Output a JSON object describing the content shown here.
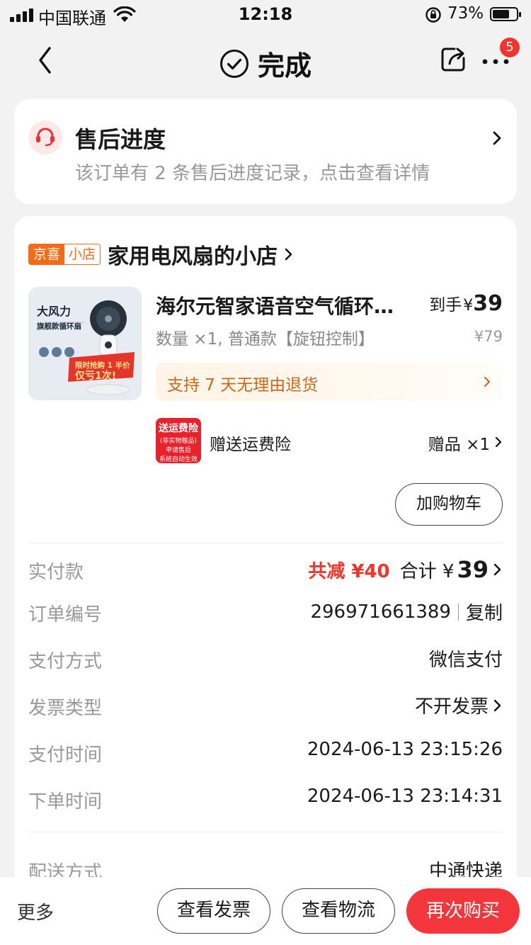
{
  "status_bar": {
    "carrier": "中国联通",
    "time": "12:18",
    "battery_percent_text": "73%",
    "battery_level": 0.73
  },
  "nav": {
    "title": "完成",
    "badge_count": "5"
  },
  "after_sale": {
    "title": "售后进度",
    "subtitle": "该订单有 2 条售后进度记录，点击查看详情"
  },
  "shop": {
    "tag_left": "京喜",
    "tag_right": "小店",
    "name": "家用电风扇的小店"
  },
  "product": {
    "title": "海尔元智家语音空气循环扇大风力旗舰款循环扇",
    "price_label": "到手",
    "price_currency": "¥",
    "price": "39",
    "spec": "数量 ×1, 普通款【旋钮控制】",
    "original_price": "¥79",
    "image_text_main": "大风力",
    "image_text_sub": "旗舰款循环扇",
    "image_promo_line1": "限时抢购 1 半价",
    "image_promo_line2": "仅亏1次!"
  },
  "return_policy": {
    "text": "支持 7 天无理由退货"
  },
  "gift": {
    "image_line1": "送运费险",
    "image_line2": "(非实物赠品)",
    "image_line3": "申请售后",
    "image_line4": "系统自动生效",
    "name": "赠送运费险",
    "count": "赠品 ×1"
  },
  "cart_button": "加购物车",
  "details": {
    "paid": {
      "label": "实付款",
      "discount": "共减 ¥40",
      "total_label": "合计 ¥",
      "total": "39"
    },
    "order_no": {
      "label": "订单编号",
      "value": "296971661389",
      "copy": "复制"
    },
    "pay_method": {
      "label": "支付方式",
      "value": "微信支付"
    },
    "invoice_type": {
      "label": "发票类型",
      "value": "不开发票"
    },
    "pay_time": {
      "label": "支付时间",
      "value": "2024-06-13 23:15:26"
    },
    "order_time": {
      "label": "下单时间",
      "value": "2024-06-13 23:14:31"
    },
    "delivery": {
      "label": "配送方式",
      "value": "中通快递"
    }
  },
  "bottom_bar": {
    "more": "更多",
    "view_invoice": "查看发票",
    "view_logistics": "查看物流",
    "buy_again": "再次购买"
  },
  "colors": {
    "accent_red": "#f3363b",
    "shop_orange": "#f36b16",
    "return_text": "#c9691b"
  }
}
